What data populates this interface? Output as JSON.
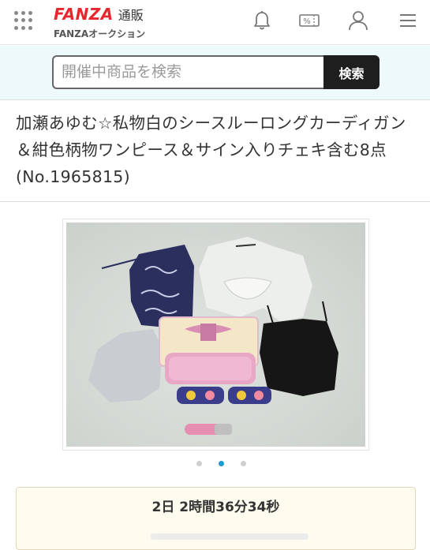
{
  "header": {
    "logo_brand": "FANZA",
    "logo_section": "通販",
    "logo_sub": "FANZAオークション",
    "icons": [
      "grid-menu-icon",
      "bell-icon",
      "coupon-icon",
      "user-icon",
      "hamburger-menu-icon"
    ],
    "coupon_symbol": "%"
  },
  "search": {
    "placeholder": "開催中商品を検索",
    "button_label": "検索"
  },
  "product": {
    "title": "加瀬あゆむ☆私物白のシースルーロングカーディガン＆紺色柄物ワンピース＆サイン入りチェキ含む8点(No.1965815)"
  },
  "gallery": {
    "slide_count": 3,
    "active_slide": 2
  },
  "auction": {
    "time_left": "2日 2時間36分34秒"
  },
  "colors": {
    "brand_red": "#e8262d",
    "search_bg": "#eef9fb",
    "button_dark": "#1e1e1e",
    "active_dot": "#1a9bd6",
    "timer_bg": "#fefcef"
  }
}
